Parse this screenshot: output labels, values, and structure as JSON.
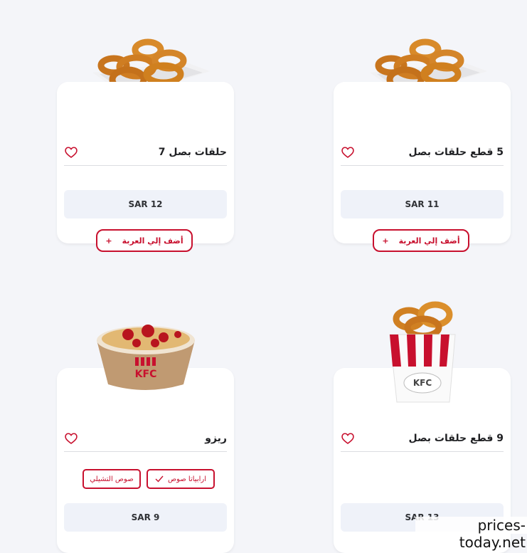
{
  "products": [
    {
      "title": "حلقات بصل 7",
      "price": "SAR 12",
      "add_label": "أضف إلي العربة",
      "plus": "+"
    },
    {
      "title": "5 قطع حلقات بصل",
      "price": "SAR 11",
      "add_label": "أضف إلي العربة",
      "plus": "+"
    },
    {
      "title": "ريزو",
      "price": "SAR 9",
      "options": [
        "ارابياتا صوص",
        "صوص التشيلي"
      ],
      "selected_option": "ارابياتا صوص"
    },
    {
      "title": "9 قطع حلقات بصل",
      "price": "SAR 13"
    }
  ],
  "brand_text": "KFC",
  "watermark": "prices-today.net",
  "colors": {
    "accent": "#c8102e",
    "background": "#f4f5f9",
    "price_bg": "#eff2f9"
  }
}
